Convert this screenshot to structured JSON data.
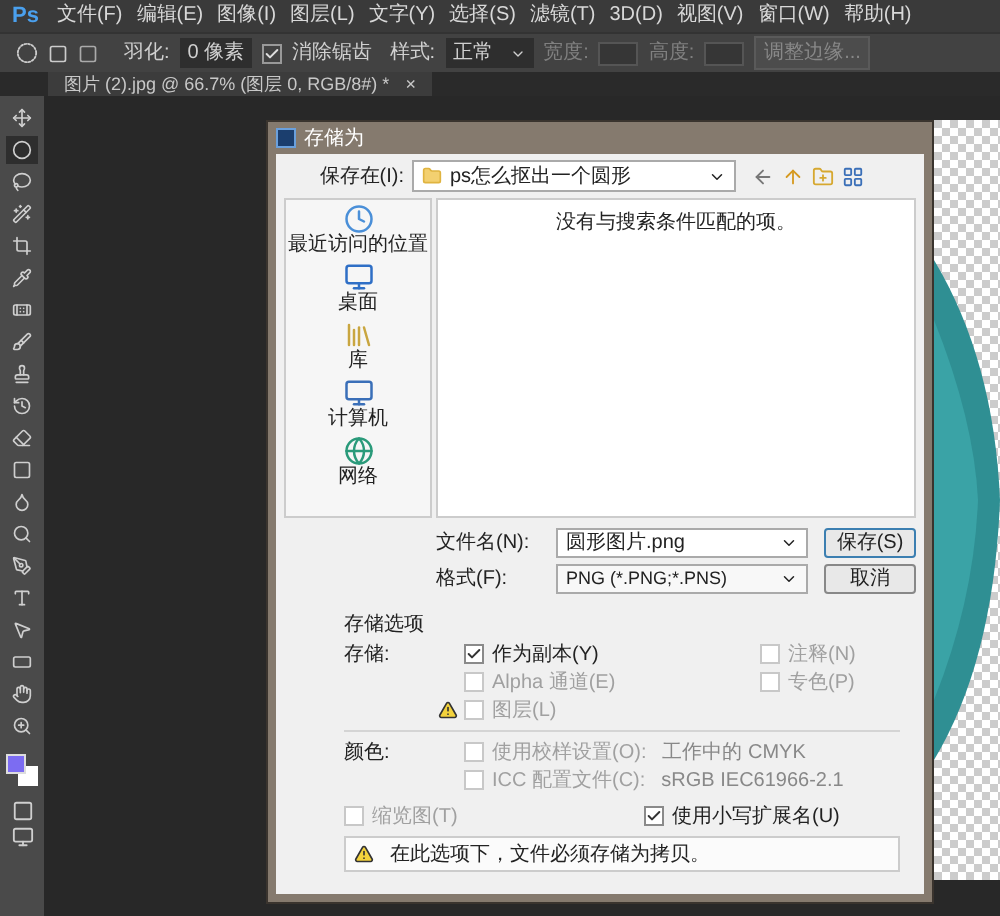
{
  "app": {
    "logo": "Ps",
    "menu": [
      "文件(F)",
      "编辑(E)",
      "图像(I)",
      "图层(L)",
      "文字(Y)",
      "选择(S)",
      "滤镜(T)",
      "3D(D)",
      "视图(V)",
      "窗口(W)",
      "帮助(H)"
    ]
  },
  "options_bar": {
    "feather_label": "羽化:",
    "feather_value": "0 像素",
    "antialias": {
      "label": "消除锯齿",
      "checked": true
    },
    "style_label": "样式:",
    "style_value": "正常",
    "width_label": "宽度:",
    "height_label": "高度:",
    "refine_button": "调整边缘..."
  },
  "document_tab": {
    "title": "图片 (2).jpg @ 66.7% (图层 0, RGB/8#) *",
    "close": "×"
  },
  "tools": [
    {
      "kind": "move",
      "selected": false
    },
    {
      "kind": "marquee",
      "selected": true
    },
    {
      "kind": "lasso",
      "selected": false
    },
    {
      "kind": "wand",
      "selected": false
    },
    {
      "kind": "crop",
      "selected": false
    },
    {
      "kind": "eyedropper",
      "selected": false
    },
    {
      "kind": "heal",
      "selected": false
    },
    {
      "kind": "brush",
      "selected": false
    },
    {
      "kind": "stamp",
      "selected": false
    },
    {
      "kind": "history",
      "selected": false
    },
    {
      "kind": "eraser",
      "selected": false
    },
    {
      "kind": "gradient",
      "selected": false
    },
    {
      "kind": "blur",
      "selected": false
    },
    {
      "kind": "dodge",
      "selected": false
    },
    {
      "kind": "pen",
      "selected": false
    },
    {
      "kind": "type",
      "selected": false
    },
    {
      "kind": "select",
      "selected": false
    },
    {
      "kind": "shape",
      "selected": false
    },
    {
      "kind": "hand",
      "selected": false
    },
    {
      "kind": "zoom",
      "selected": false
    }
  ],
  "dialog": {
    "title": "存储为",
    "save_in_label": "保存在(I):",
    "folder": "ps怎么抠出一个圆形",
    "places": [
      {
        "kind": "recent",
        "label": "最近访问的位置"
      },
      {
        "kind": "desktop",
        "label": "桌面"
      },
      {
        "kind": "library",
        "label": "库"
      },
      {
        "kind": "computer",
        "label": "计算机"
      },
      {
        "kind": "network",
        "label": "网络"
      }
    ],
    "empty_message": "没有与搜索条件匹配的项。",
    "filename_label": "文件名(N):",
    "filename": "圆形图片.png",
    "format_label": "格式(F):",
    "format": "PNG (*.PNG;*.PNS)",
    "buttons": [
      "保存(S)",
      "取消"
    ],
    "save_options": {
      "heading": "存储选项",
      "save_label": "存储:",
      "save_checks": [
        {
          "label": "作为副本(Y)",
          "checked": true,
          "disabled": false,
          "warning": false
        },
        {
          "label": "注释(N)",
          "checked": false,
          "disabled": true,
          "warning": false
        },
        {
          "label": "Alpha 通道(E)",
          "checked": false,
          "disabled": true,
          "warning": false
        },
        {
          "label": "专色(P)",
          "checked": false,
          "disabled": true,
          "warning": false
        },
        {
          "label": "图层(L)",
          "checked": false,
          "disabled": true,
          "warning": true
        }
      ],
      "color_label": "颜色:",
      "color_checks": [
        {
          "label": "使用校样设置(O):",
          "value": "工作中的 CMYK",
          "checked": false,
          "disabled": true
        },
        {
          "label": "ICC 配置文件(C):",
          "value": "sRGB IEC61966-2.1",
          "checked": false,
          "disabled": true
        }
      ],
      "thumbnail": {
        "label": "缩览图(T)",
        "checked": false,
        "disabled": true
      },
      "lowercase": {
        "label": "使用小写扩展名(U)",
        "checked": true,
        "disabled": false
      },
      "warning_message": "在此选项下，文件必须存储为拷贝。"
    }
  }
}
